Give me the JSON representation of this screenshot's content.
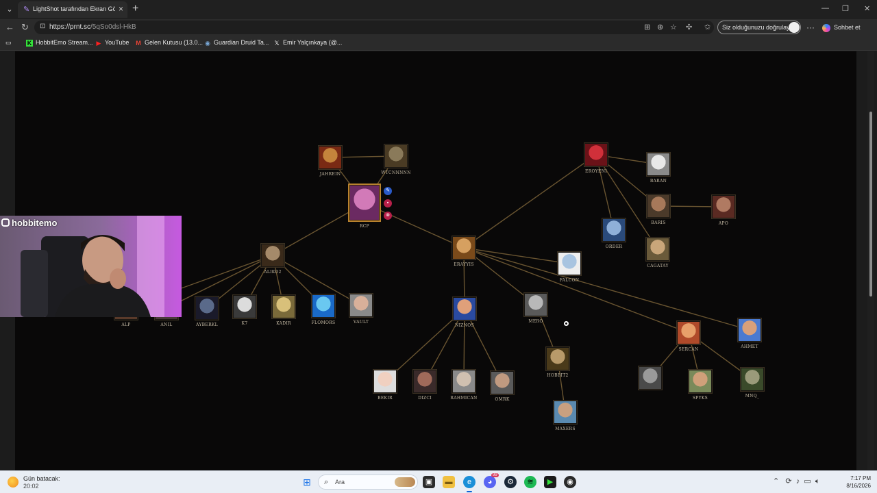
{
  "browser": {
    "tab_title": "LightShot tarafından Ekran Görünt",
    "url_host": "https://prnt.sc",
    "url_path": "/5qSo0dsl-HkB",
    "verify_label": "Siz olduğunuzu doğrulayın",
    "copilot_label": "Sohbet et",
    "bookmarks": [
      {
        "label": "HobbitEmo Stream...",
        "icon": "kick-icon",
        "color": "#35e23b"
      },
      {
        "label": "YouTube",
        "icon": "youtube-icon",
        "color": "#ff2020"
      },
      {
        "label": "Gelen Kutusu (13.0...",
        "icon": "gmail-icon",
        "color": "#e94335"
      },
      {
        "label": "Guardian Druid Ta...",
        "icon": "wowhead-icon",
        "color": "#7aa9d8"
      },
      {
        "label": "Emir Yalçınkaya (@...",
        "icon": "x-icon",
        "color": "#ffffff"
      }
    ]
  },
  "graph": {
    "nodes": [
      {
        "id": "jahrein",
        "label": "JAHREIN",
        "c1": "#c4843c",
        "c2": "#7a2a14"
      },
      {
        "id": "wtcn",
        "label": "WTCNNNNN",
        "c1": "#8a7a5a",
        "c2": "#4a3b24"
      },
      {
        "id": "rcp",
        "label": "RCP",
        "c1": "#d27ab8",
        "c2": "#6b2a62"
      },
      {
        "id": "eroyeni",
        "label": "EROYENI",
        "c1": "#d0303a",
        "c2": "#6a1218"
      },
      {
        "id": "baran",
        "label": "BARAN",
        "c1": "#e8e8e8",
        "c2": "#8a8a8a"
      },
      {
        "id": "baris",
        "label": "BARIS",
        "c1": "#a7795a",
        "c2": "#4b3a2a"
      },
      {
        "id": "apo",
        "label": "APO",
        "c1": "#b07a62",
        "c2": "#5a2a22"
      },
      {
        "id": "order",
        "label": "ORDER",
        "c1": "#8fb0d8",
        "c2": "#2a4a7a"
      },
      {
        "id": "cagatay",
        "label": "CAGATAY",
        "c1": "#c9a67a",
        "c2": "#6a5a3a"
      },
      {
        "id": "erayyis",
        "label": "ERAYYIS",
        "c1": "#d6a060",
        "c2": "#7a4a1a"
      },
      {
        "id": "falcon",
        "label": "FALCON",
        "c1": "#a8c4e0",
        "c2": "#eeeeee"
      },
      {
        "id": "aliko",
        "label": "ALIKO2",
        "c1": "#a58a6a",
        "c2": "#3a2a1a"
      },
      {
        "id": "alp",
        "label": "ALP",
        "c1": "#c07a4a",
        "c2": "#5a3a2a"
      },
      {
        "id": "anil",
        "label": "ANIL",
        "c1": "#9a7a6a",
        "c2": "#4a3a3a"
      },
      {
        "id": "ayberk",
        "label": "AYBERKL",
        "c1": "#5a6a8a",
        "c2": "#1a1a2a"
      },
      {
        "id": "k7",
        "label": "K7",
        "c1": "#dcdcdc",
        "c2": "#3a3a3a"
      },
      {
        "id": "kadir",
        "label": "KADIR",
        "c1": "#d8c07a",
        "c2": "#7a6a3a"
      },
      {
        "id": "flomors",
        "label": "FLOMORS",
        "c1": "#6ac8f0",
        "c2": "#1a6ac8"
      },
      {
        "id": "vault",
        "label": "VAULT",
        "c1": "#d8b09a",
        "c2": "#8a8a8a"
      },
      {
        "id": "niznos",
        "label": "NIZNOS",
        "c1": "#e0a07a",
        "c2": "#2a4aa0"
      },
      {
        "id": "mero",
        "label": "MERO",
        "c1": "#b8b8b8",
        "c2": "#5a5a5a"
      },
      {
        "id": "sercan",
        "label": "SERCAN",
        "c1": "#e8a06a",
        "c2": "#b04a2a"
      },
      {
        "id": "ahmet",
        "label": "AHMET",
        "c1": "#d8a07a",
        "c2": "#4a7ad0"
      },
      {
        "id": "hobbit2",
        "label": "HOBBIT2",
        "c1": "#b89a6a",
        "c2": "#4a3a1a"
      },
      {
        "id": "bekir",
        "label": "BEKIR",
        "c1": "#f0d0c0",
        "c2": "#dddddd"
      },
      {
        "id": "dizci",
        "label": "DIZCI",
        "c1": "#a06a5a",
        "c2": "#3a2a2a"
      },
      {
        "id": "rahmican",
        "label": "RAHMICAN",
        "c1": "#d0c0b0",
        "c2": "#8a8a8a"
      },
      {
        "id": "omrk",
        "label": "OMRK",
        "c1": "#c09a80",
        "c2": "#5a5a5a"
      },
      {
        "id": "maxers",
        "label": "MAXERS",
        "c1": "#c8a080",
        "c2": "#5a8ab0"
      },
      {
        "id": "banned",
        "label": "",
        "c1": "#9a9a9a",
        "c2": "#4a4a4a"
      },
      {
        "id": "spyks",
        "label": "SPYKS",
        "c1": "#d0a07a",
        "c2": "#7a8a5a"
      },
      {
        "id": "mnq",
        "label": "MNQ_",
        "c1": "#9a9a7a",
        "c2": "#3a4a2a"
      }
    ],
    "edges": [
      [
        "jahrein",
        "wtcn"
      ],
      [
        "jahrein",
        "rcp"
      ],
      [
        "wtcn",
        "rcp"
      ],
      [
        "rcp",
        "aliko"
      ],
      [
        "rcp",
        "erayyis"
      ],
      [
        "erayyis",
        "eroyeni"
      ],
      [
        "eroyeni",
        "baran"
      ],
      [
        "eroyeni",
        "baris"
      ],
      [
        "eroyeni",
        "order"
      ],
      [
        "eroyeni",
        "cagatay"
      ],
      [
        "baris",
        "apo"
      ],
      [
        "erayyis",
        "falcon"
      ],
      [
        "erayyis",
        "niznos"
      ],
      [
        "erayyis",
        "mero"
      ],
      [
        "erayyis",
        "sercan"
      ],
      [
        "erayyis",
        "ahmet"
      ],
      [
        "aliko",
        "alp"
      ],
      [
        "aliko",
        "anil"
      ],
      [
        "aliko",
        "ayberk"
      ],
      [
        "aliko",
        "k7"
      ],
      [
        "aliko",
        "kadir"
      ],
      [
        "aliko",
        "flomors"
      ],
      [
        "aliko",
        "vault"
      ],
      [
        "niznos",
        "bekir"
      ],
      [
        "niznos",
        "dizci"
      ],
      [
        "niznos",
        "rahmican"
      ],
      [
        "niznos",
        "omrk"
      ],
      [
        "mero",
        "hobbit2"
      ],
      [
        "hobbit2",
        "maxers"
      ],
      [
        "sercan",
        "banned"
      ],
      [
        "sercan",
        "spyks"
      ],
      [
        "sercan",
        "mnq"
      ]
    ]
  },
  "webcam": {
    "handle": "hobbitemo"
  },
  "taskbar": {
    "weather_title": "Gün batacak:",
    "weather_time": "20:02",
    "search_placeholder": "Ara",
    "time": "7:17 PM",
    "date": "8/16/2026",
    "badge_count": "99"
  }
}
